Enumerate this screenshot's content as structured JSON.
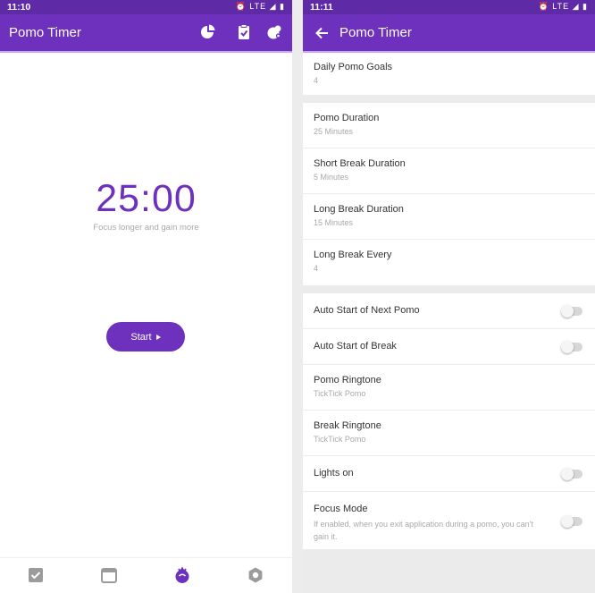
{
  "left": {
    "status_time": "11:10",
    "status_icons": "⏰ LTE ◢ ▮",
    "title": "Pomo Timer",
    "timer": "25:00",
    "timer_sub": "Focus longer and gain more",
    "start_label": "Start",
    "appbar_icons": [
      "statistics-pie-icon",
      "task-clipboard-icon",
      "white-noise-icon"
    ],
    "nav_icons": [
      "task-checkbox-icon",
      "calendar-icon",
      "pomo-timer-icon",
      "settings-gear-icon"
    ],
    "accent": "#6d31bd"
  },
  "right": {
    "status_time": "11:11",
    "status_icons": "⏰ LTE ◢ ▮",
    "title": "Pomo Timer",
    "settings": {
      "daily_goals": {
        "title": "Daily Pomo Goals",
        "value": "4"
      },
      "pomo_duration": {
        "title": "Pomo Duration",
        "value": "25 Minutes"
      },
      "short_break": {
        "title": "Short Break Duration",
        "value": "5 Minutes"
      },
      "long_break": {
        "title": "Long Break Duration",
        "value": "15 Minutes"
      },
      "long_break_every": {
        "title": "Long Break Every",
        "value": "4"
      },
      "auto_next_pomo": {
        "title": "Auto Start of Next Pomo",
        "enabled": false
      },
      "auto_break": {
        "title": "Auto Start of Break",
        "enabled": false
      },
      "pomo_ringtone": {
        "title": "Pomo Ringtone",
        "value": "TickTick Pomo"
      },
      "break_ringtone": {
        "title": "Break Ringtone",
        "value": "TickTick Pomo"
      },
      "lights_on": {
        "title": "Lights on",
        "enabled": false
      },
      "focus_mode": {
        "title": "Focus Mode",
        "desc": "If enabled, when you exit application during a pomo, you can't gain it.",
        "enabled": false
      }
    }
  }
}
